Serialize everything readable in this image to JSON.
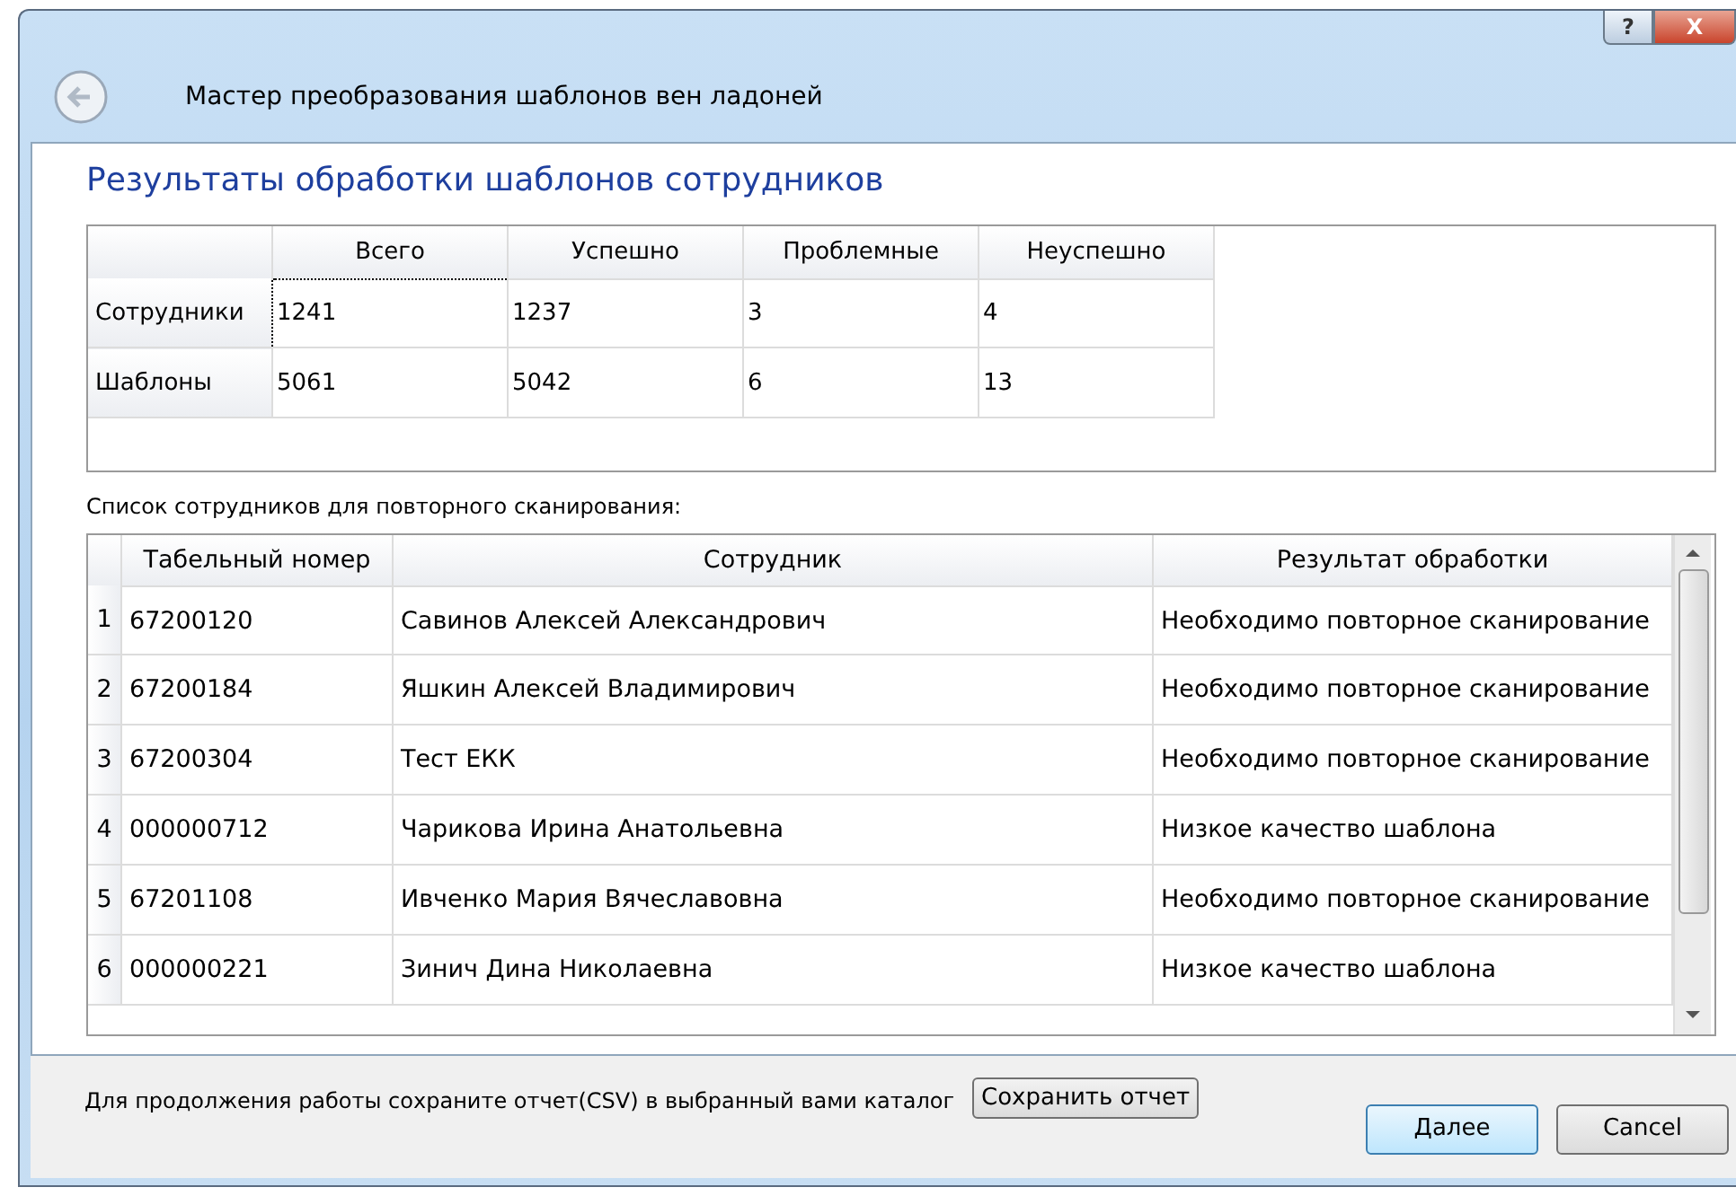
{
  "window": {
    "title": "Мастер преобразования шаблонов вен ладоней",
    "buttons": [
      "?",
      "X"
    ]
  },
  "heading": "Результаты обработки шаблонов сотрудников",
  "summary": {
    "columns": [
      "Всего",
      "Успешно",
      "Проблемные",
      "Неуспешно"
    ],
    "rows": [
      {
        "label": "Сотрудники",
        "cells": [
          {
            "value": "1241",
            "selected": true
          },
          {
            "value": "1237",
            "selected": false
          },
          {
            "value": "3",
            "selected": false
          },
          {
            "value": "4",
            "selected": false
          }
        ]
      },
      {
        "label": "Шаблоны",
        "cells": [
          {
            "value": "5061",
            "selected": false
          },
          {
            "value": "5042",
            "selected": false
          },
          {
            "value": "6",
            "selected": false
          },
          {
            "value": "13",
            "selected": false
          }
        ]
      }
    ]
  },
  "list_label": "Список сотрудников для повторного сканирования:",
  "list": {
    "columns": [
      "Табельный номер",
      "Сотрудник",
      "Результат обработки"
    ],
    "rows": [
      {
        "index": "1",
        "cells": [
          "67200120",
          "Савинов Алексей Александрович",
          "Необходимо повторное сканирование"
        ]
      },
      {
        "index": "2",
        "cells": [
          "67200184",
          "Яшкин Алексей Владимирович",
          "Необходимо повторное сканирование"
        ]
      },
      {
        "index": "3",
        "cells": [
          "67200304",
          "Тест ЕКК",
          "Необходимо повторное сканирование"
        ]
      },
      {
        "index": "4",
        "cells": [
          "000000712",
          "Чарикова Ирина Анатольевна",
          "Низкое качество шаблона"
        ]
      },
      {
        "index": "5",
        "cells": [
          "67201108",
          "Ивченко Мария Вячеславовна",
          "Необходимо повторное сканирование"
        ]
      },
      {
        "index": "6",
        "cells": [
          "000000221",
          "Зинич Дина Николаевна",
          "Низкое качество шаблона"
        ]
      }
    ]
  },
  "footer": {
    "note": "Для продолжения работы сохраните отчет(CSV) в выбранный вами каталог",
    "save_button": "Сохранить отчет",
    "next_button": "Далее",
    "cancel_button": "Cancel"
  }
}
